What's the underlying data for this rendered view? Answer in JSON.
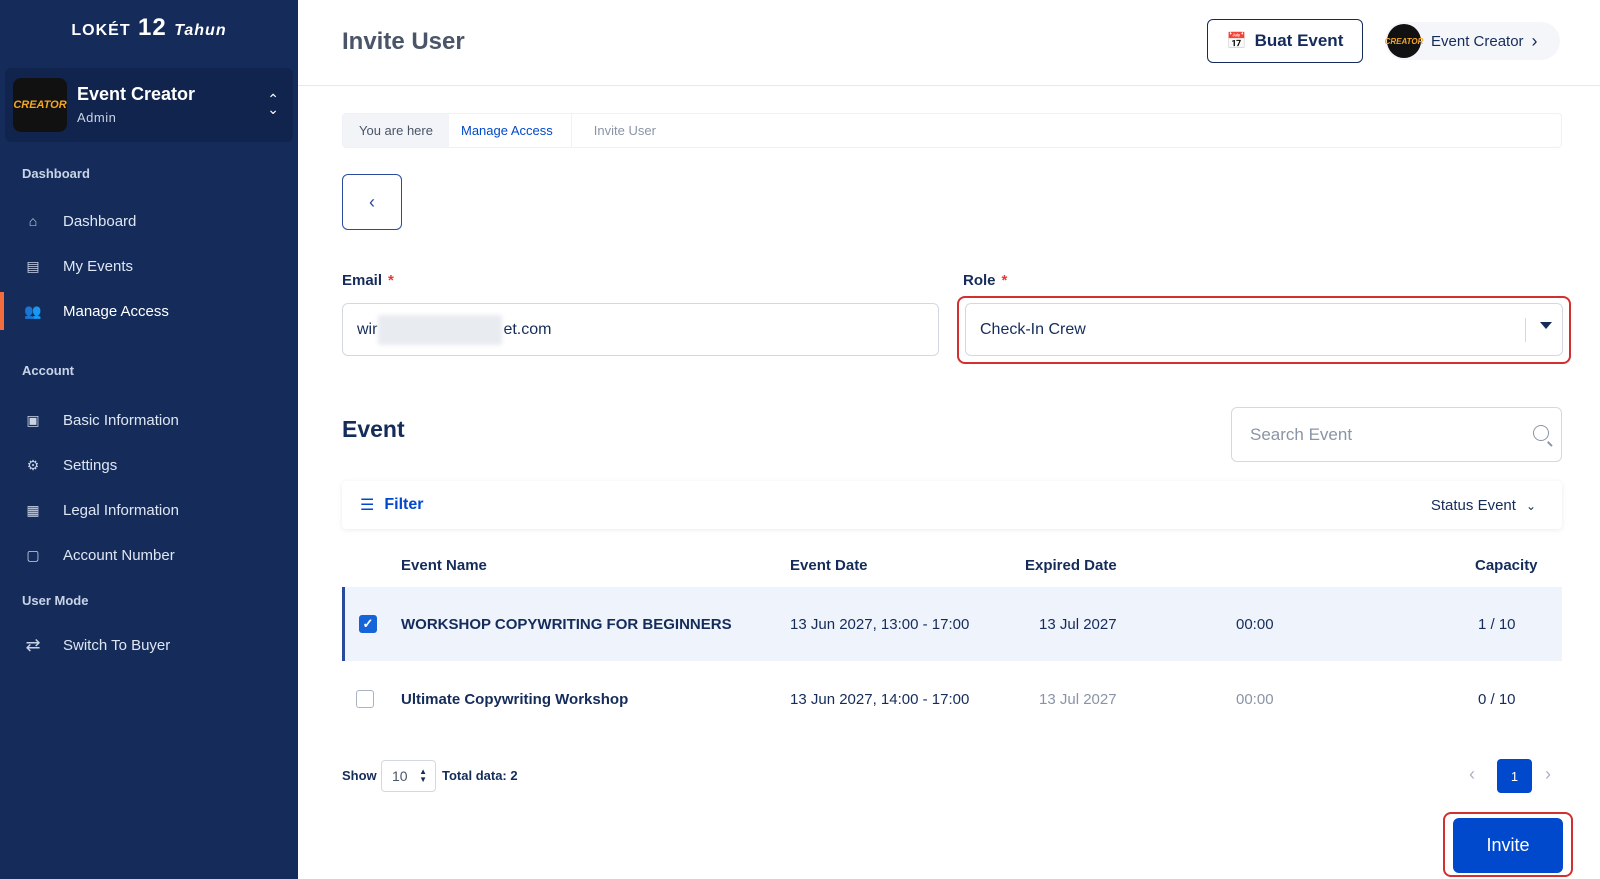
{
  "logo": {
    "brand": "LOKÉT",
    "number": "12",
    "tahun": "Tahun"
  },
  "profile": {
    "avatar_text": "CREATOR",
    "name": "Event Creator",
    "role": "Admin"
  },
  "sidebar": {
    "dashboard_section": "Dashboard",
    "account_section": "Account",
    "usermode_section": "User Mode",
    "items": [
      {
        "label": "Dashboard",
        "icon": "home-icon"
      },
      {
        "label": "My Events",
        "icon": "document-icon"
      },
      {
        "label": "Manage Access",
        "icon": "users-icon",
        "active": true
      },
      {
        "label": "Basic Information",
        "icon": "id-card-icon"
      },
      {
        "label": "Settings",
        "icon": "gear-icon"
      },
      {
        "label": "Legal Information",
        "icon": "briefcase-icon"
      },
      {
        "label": "Account Number",
        "icon": "account-icon"
      },
      {
        "label": "Switch To Buyer",
        "icon": "switch-icon"
      }
    ]
  },
  "header": {
    "title": "Invite User",
    "buat_event": "Buat Event",
    "user_name": "Event Creator",
    "user_avatar_text": "CREATOR"
  },
  "breadcrumb": {
    "here": "You are here",
    "link": "Manage Access",
    "current": "Invite User"
  },
  "form": {
    "email_label": "Email",
    "email_prefix": "wir",
    "email_suffix": "et.com",
    "role_label": "Role",
    "role_value": "Check-In Crew",
    "required_mark": "*"
  },
  "events": {
    "heading": "Event",
    "search_placeholder": "Search Event",
    "filter_label": "Filter",
    "status_label": "Status Event",
    "columns": [
      "Event Name",
      "Event Date",
      "Expired Date",
      "Capacity"
    ],
    "rows": [
      {
        "checked": true,
        "name": "WORKSHOP COPYWRITING FOR BEGINNERS",
        "event_date": "13 Jun 2027, 13:00 - 17:00",
        "expired_date": "13 Jul 2027",
        "expired_time": "00:00",
        "capacity": "1 / 10"
      },
      {
        "checked": false,
        "name": "Ultimate Copywriting Workshop",
        "event_date": "13 Jun 2027, 14:00 - 17:00",
        "expired_date": "13 Jul 2027",
        "expired_time": "00:00",
        "capacity": "0 / 10"
      }
    ]
  },
  "pagination": {
    "show_label": "Show",
    "page_size": "10",
    "total_label": "Total data: 2",
    "current_page": "1"
  },
  "invite_label": "Invite",
  "colors": {
    "sidebar": "#152c5b",
    "primary": "#0049cc",
    "highlight": "#d32f2f",
    "active_marker": "#f26d3d"
  }
}
